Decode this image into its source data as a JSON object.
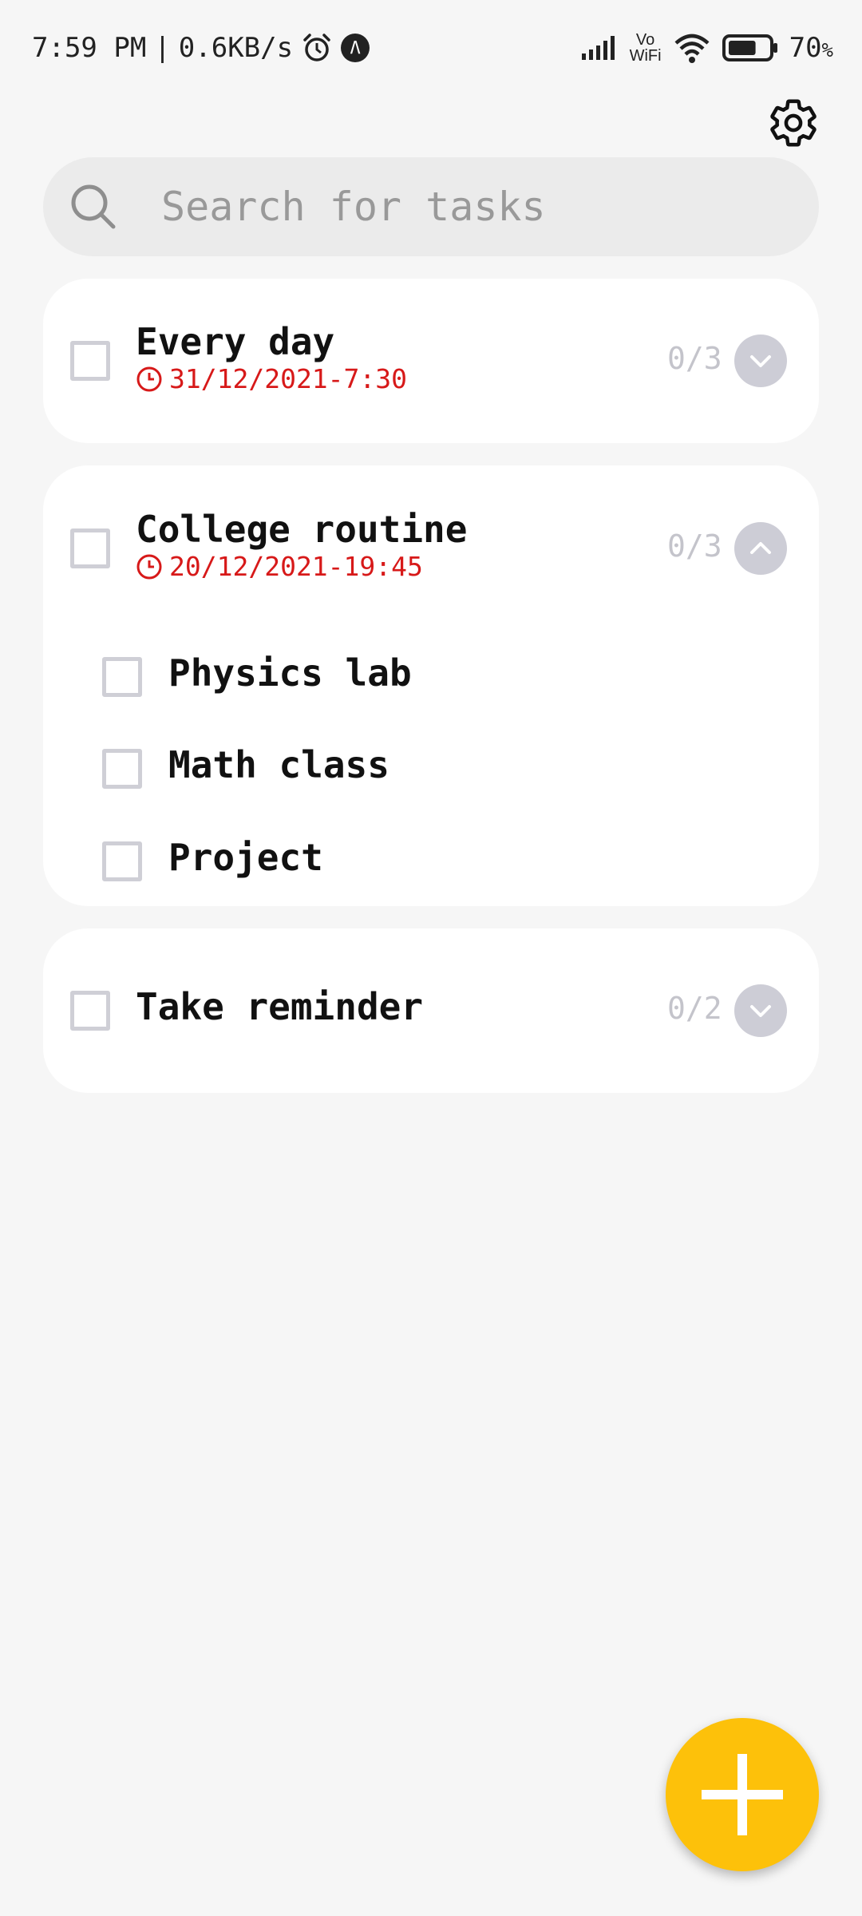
{
  "status_bar": {
    "time": "7:59 PM",
    "separator": "|",
    "network_speed": "0.6KB/s",
    "badge_glyph": "Λ",
    "vowifi_top": "Vo",
    "vowifi_bottom": "WiFi",
    "battery_percent": "70",
    "battery_unit": "%",
    "battery_level": 0.7
  },
  "search": {
    "placeholder": "Search for tasks",
    "value": ""
  },
  "tasks": [
    {
      "title": "Every day",
      "due": "31/12/2021-7:30",
      "progress": "0/3",
      "expanded": false,
      "subtasks": []
    },
    {
      "title": "College routine",
      "due": "20/12/2021-19:45",
      "progress": "0/3",
      "expanded": true,
      "subtasks": [
        {
          "title": "Physics lab"
        },
        {
          "title": "Math class"
        },
        {
          "title": "Project"
        }
      ]
    },
    {
      "title": "Take reminder",
      "due": "",
      "progress": "0/2",
      "expanded": false,
      "subtasks": []
    }
  ],
  "icons": {
    "settings": "gear-icon",
    "search": "search-icon",
    "add": "plus-icon",
    "due": "clock-icon",
    "expand": "chevron-down-icon",
    "collapse": "chevron-up-icon"
  },
  "colors": {
    "background": "#f6f6f6",
    "card": "#ffffff",
    "due_text": "#d71919",
    "fab": "#fdc10a",
    "toggle": "#cdcdd6"
  }
}
